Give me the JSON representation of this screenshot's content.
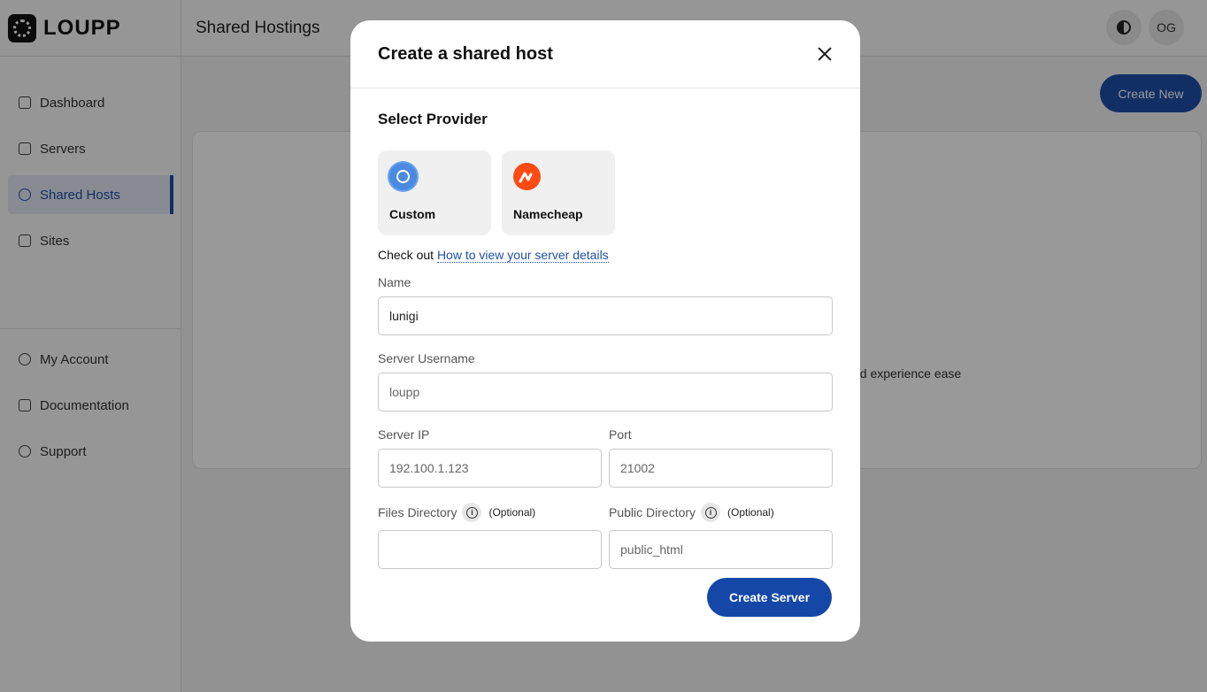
{
  "app": {
    "logo_text": "LOUPP"
  },
  "sidebar": {
    "items": [
      {
        "label": "Dashboard",
        "icon": "home-icon"
      },
      {
        "label": "Servers",
        "icon": "layers-icon"
      },
      {
        "label": "Shared Hosts",
        "icon": "cloud-icon",
        "active": true
      },
      {
        "label": "Sites",
        "icon": "database-icon"
      }
    ],
    "bottom_items": [
      {
        "label": "My Account",
        "icon": "user-icon"
      },
      {
        "label": "Documentation",
        "icon": "book-icon"
      },
      {
        "label": "Support",
        "icon": "support-icon"
      }
    ]
  },
  "topbar": {
    "title": "Shared Hostings",
    "avatar_initials": "OG"
  },
  "page": {
    "create_new_label": "Create New",
    "background_text": "nd experience ease"
  },
  "modal": {
    "title": "Create a shared host",
    "section_title": "Select Provider",
    "providers": [
      {
        "label": "Custom",
        "icon": "kubernetes-icon"
      },
      {
        "label": "Namecheap",
        "icon": "namecheap-icon"
      }
    ],
    "checkout_prefix": "Check out",
    "checkout_link": "How to view your server details",
    "fields": {
      "name": {
        "label": "Name",
        "value": "lunigi"
      },
      "username": {
        "label": "Server Username",
        "placeholder": "loupp"
      },
      "ip": {
        "label": "Server IP",
        "placeholder": "192.100.1.123"
      },
      "port": {
        "label": "Port",
        "placeholder": "21002"
      },
      "files_dir": {
        "label": "Files Directory",
        "optional": "(Optional)",
        "placeholder": ""
      },
      "public_dir": {
        "label": "Public Directory",
        "optional": "(Optional)",
        "placeholder": "public_html"
      }
    },
    "submit_label": "Create Server"
  }
}
